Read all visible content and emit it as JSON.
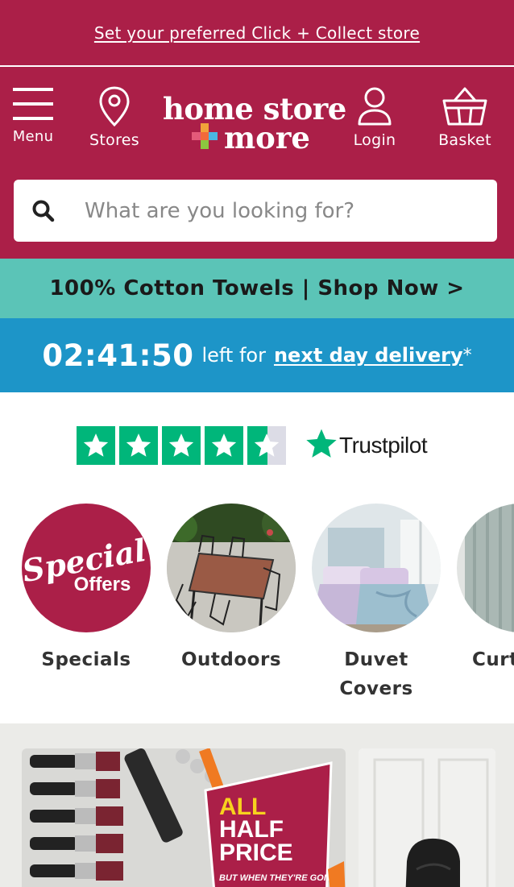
{
  "topbar": {
    "link_text": "Set your preferred Click + Collect store"
  },
  "header": {
    "menu_label": "Menu",
    "stores_label": "Stores",
    "logo_line1": "home store",
    "logo_line2": "more",
    "login_label": "Login",
    "basket_label": "Basket",
    "brand_color": "#ab1f48"
  },
  "search": {
    "placeholder": "What are you looking for?",
    "value": ""
  },
  "promo": {
    "text": "100% Cotton Towels | Shop Now >"
  },
  "delivery": {
    "timer": "02:41:50",
    "left_for": "left for",
    "link_text": "next day delivery",
    "asterisk": "*"
  },
  "trustpilot": {
    "brand": "Trustpilot",
    "rating_stars": 4.5,
    "max_stars": 5
  },
  "categories": [
    {
      "label": "Specials",
      "image_text_1": "Special",
      "image_text_2": "Offers"
    },
    {
      "label": "Outdoors"
    },
    {
      "label": "Duvet Covers"
    },
    {
      "label": "Curt"
    }
  ],
  "banners": {
    "half_price_line1": "ALL",
    "half_price_line2": "HALF",
    "half_price_line3": "PRICE",
    "half_price_small": "BUT WHEN THEY'RE GONE"
  }
}
